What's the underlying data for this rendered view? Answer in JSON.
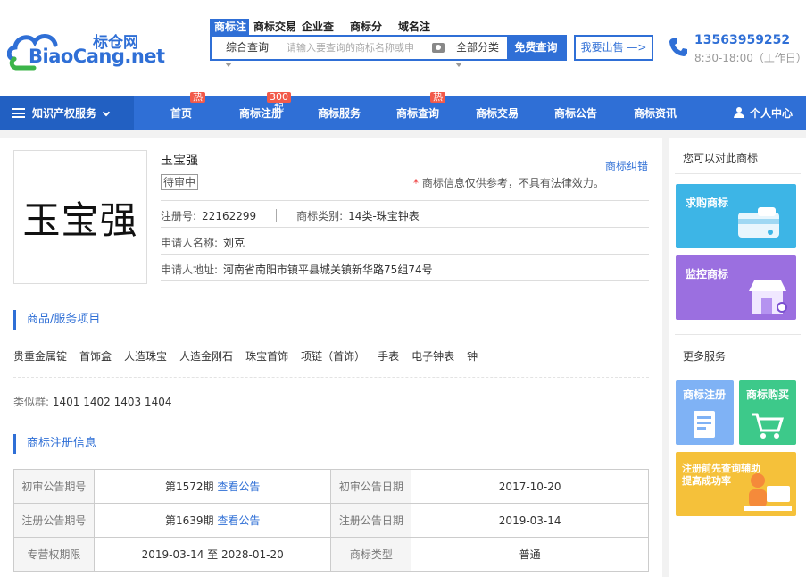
{
  "header": {
    "logo_cn": "标仓网",
    "logo_en": "BiaoCang.net",
    "search_tabs": [
      "商标注",
      "商标交易",
      "企业查",
      "商标分",
      "域名注"
    ],
    "search_scope": "综合查询",
    "search_placeholder": "请输入要查询的商标名称或申",
    "search_category": "全部分类",
    "search_button": "免费查询",
    "sell_button": "我要出售 —>",
    "phone": "13563959252",
    "hours": "8:30-18:00（工作日）"
  },
  "nav": {
    "category_label": "知识产权服务",
    "items": [
      {
        "label": "首页",
        "badge": "热"
      },
      {
        "label": "商标注册",
        "badge": "300起"
      },
      {
        "label": "商标服务",
        "badge": ""
      },
      {
        "label": "商标查询",
        "badge": "热"
      },
      {
        "label": "商标交易",
        "badge": ""
      },
      {
        "label": "商标公告",
        "badge": ""
      },
      {
        "label": "商标资讯",
        "badge": ""
      }
    ],
    "user_center": "个人中心"
  },
  "trademark": {
    "image_text": "玉宝强",
    "name": "玉宝强",
    "status": "待审中",
    "error_link": "商标纠错",
    "notice_star": "*",
    "notice": "商标信息仅供参考，不具有法律效力。",
    "reg_no_label": "注册号:",
    "reg_no": "22162299",
    "class_label": "商标类别:",
    "class": "14类-珠宝钟表",
    "applicant_label": "申请人名称:",
    "applicant": "刘克",
    "address_label": "申请人地址:",
    "address": "河南省南阳市镇平县城关镇新华路75组74号"
  },
  "goods": {
    "title": "商品/服务项目",
    "items": [
      "贵重金属锭",
      "首饰盒",
      "人造珠宝",
      "人造金刚石",
      "珠宝首饰",
      "项链（首饰）",
      "手表",
      "电子钟表",
      "钟"
    ],
    "similar_label": "类似群:",
    "similar_groups": "1401 1402 1403 1404"
  },
  "registration": {
    "title": "商标注册信息",
    "rows": [
      {
        "l1": "初审公告期号",
        "v1": "第1572期",
        "link1": "查看公告",
        "l2": "初审公告日期",
        "v2": "2017-10-20"
      },
      {
        "l1": "注册公告期号",
        "v1": "第1639期",
        "link1": "查看公告",
        "l2": "注册公告日期",
        "v2": "2019-03-14"
      },
      {
        "l1": "专营权期限",
        "v1": "2019-03-14 至 2028-01-20",
        "link1": "",
        "l2": "商标类型",
        "v2": "普通"
      }
    ]
  },
  "sidebar": {
    "title1": "您可以对此商标",
    "buy_label": "求购商标",
    "monitor_label": "监控商标",
    "title2": "更多服务",
    "reg_label": "商标注册",
    "purchase_label": "商标购买",
    "query_label": "注册前先查询辅助提高成功率",
    "colors": {
      "buy": "#3db5e6",
      "monitor": "#9b6fe0",
      "reg": "#7fb2f5",
      "purchase": "#3dc98a",
      "query": "#f5c13a"
    }
  }
}
